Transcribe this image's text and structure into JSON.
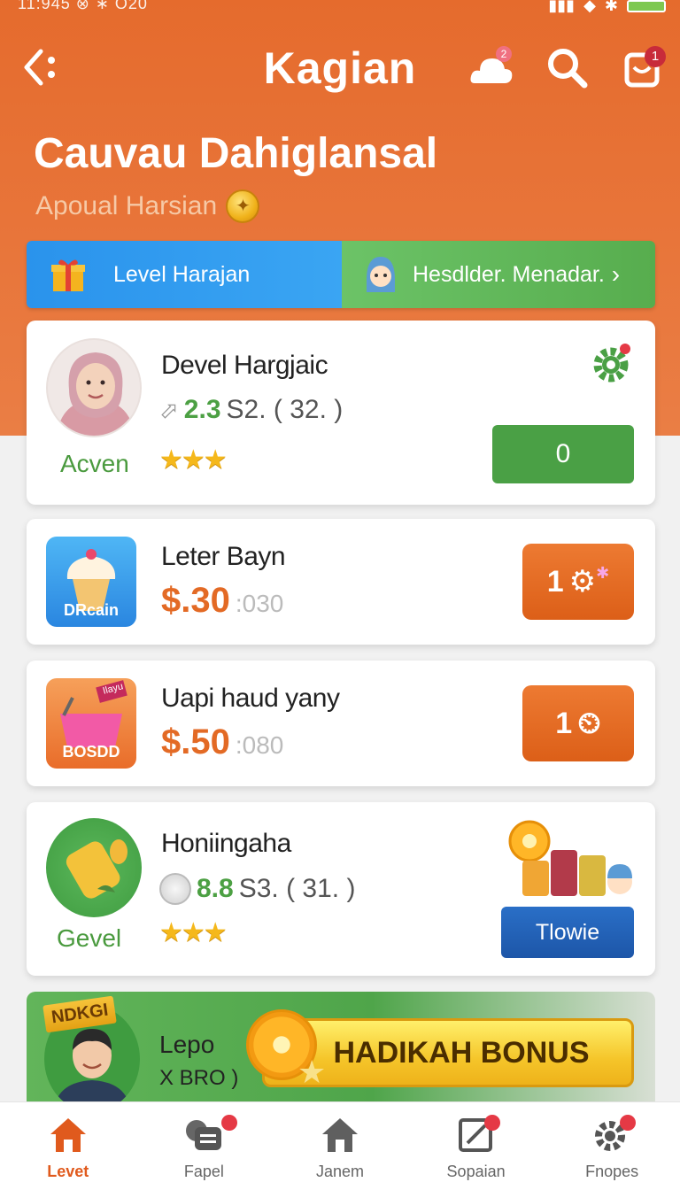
{
  "status_bar": {
    "time": "11:945 ⊗ ∗ O20"
  },
  "header": {
    "title": "Kagian",
    "cloud_badge": "2",
    "cart_badge": "1"
  },
  "hero": {
    "title": "Cauvau Dahiglansal",
    "subtitle": "Apoual Harsian"
  },
  "level_banner": {
    "left_label": "Level Harajan",
    "right_label": "Hesdlder. Menadar."
  },
  "cards": [
    {
      "type": "profile",
      "title": "Devel Hargjaic",
      "rating": "2.3",
      "rating_meta": "S2. ( 32. )",
      "tag": "Acven",
      "stars": "★★★",
      "button": "0"
    },
    {
      "type": "product",
      "title": "Leter Bayn",
      "price": "$.30",
      "price_sub": ":030",
      "image_tag": "DRcain",
      "button": "1"
    },
    {
      "type": "product",
      "title": "Uapi haud yany",
      "price": "$.50",
      "price_sub": ":080",
      "image_tag": "BOSDD",
      "image_label": "Ilayu",
      "button": "1"
    },
    {
      "type": "profile",
      "title": "Honiingaha",
      "rating": "8.8",
      "rating_meta": "S3. ( 31. )",
      "tag": "Gevel",
      "stars": "★★★",
      "button": "Tlowie"
    }
  ],
  "bonus": {
    "tag": "NDKGI",
    "title": "Lepo",
    "subtitle": "X BRO )",
    "button": "HADIKAH BONUS"
  },
  "bottom_nav": [
    {
      "label": "Levet",
      "icon": "home-icon",
      "active": true
    },
    {
      "label": "Fapel",
      "icon": "chat-icon",
      "active": false
    },
    {
      "label": "Janem",
      "icon": "house-icon",
      "active": false
    },
    {
      "label": "Sopaian",
      "icon": "edit-icon",
      "active": false
    },
    {
      "label": "Fnopes",
      "icon": "gear-icon",
      "active": false
    }
  ],
  "colors": {
    "header_orange": "#e56b2d",
    "accent_green": "#4aa045",
    "accent_blue": "#2a93ec",
    "price_orange": "#e36a25"
  }
}
